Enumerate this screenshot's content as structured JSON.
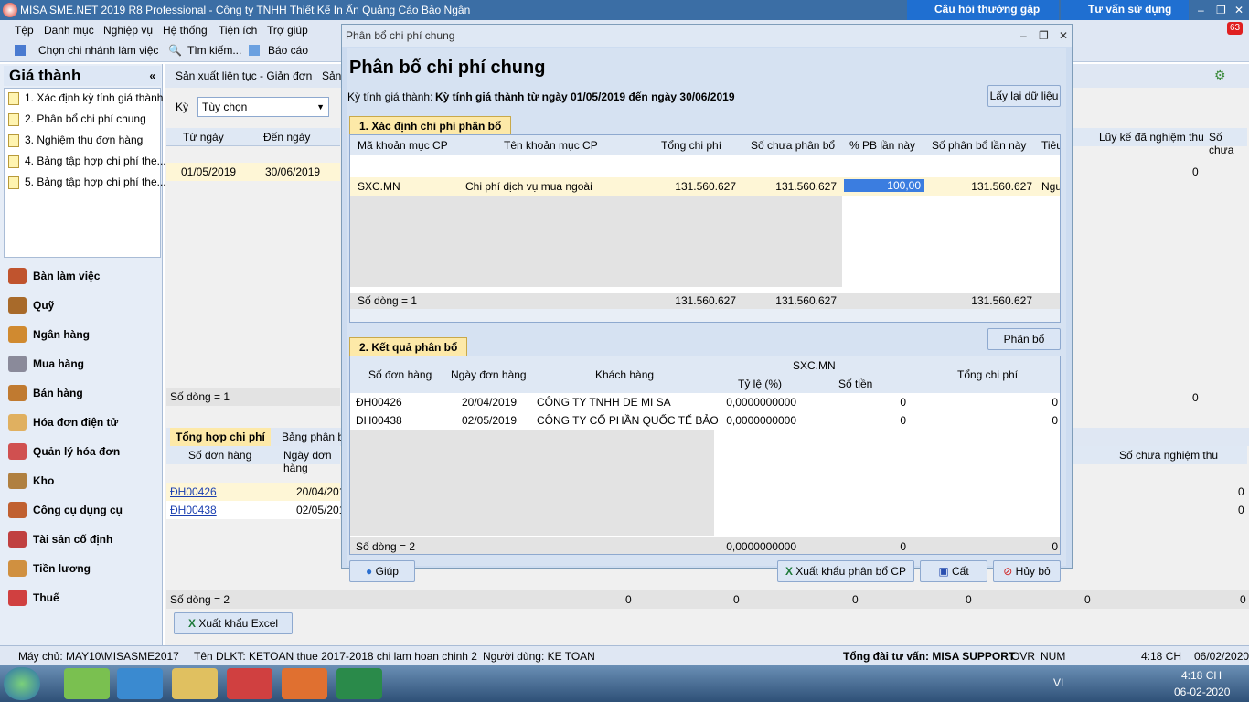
{
  "app": {
    "title": "MISA SME.NET 2019 R8 Professional - Công ty TNHH Thiết Kế In Ấn Quảng Cáo Bảo Ngân",
    "faq": "Câu hỏi thường gặp",
    "consult": "Tư vấn sử dụng",
    "badge": "63"
  },
  "menu": [
    "Tệp",
    "Danh mục",
    "Nghiệp vụ",
    "Hệ thống",
    "Tiện ích",
    "Trợ giúp"
  ],
  "toolbar": {
    "branch": "Chọn chi nhánh làm việc",
    "search": "Tìm kiếm...",
    "report": "Báo cáo"
  },
  "left": {
    "heading": "Giá thành",
    "steps": [
      "1. Xác định kỳ tính giá thành",
      "2. Phân bổ chi phí chung",
      "3. Nghiệm thu đơn hàng",
      "4. Bảng tập hợp chi phí the...",
      "5. Bảng tập hợp chi phí the..."
    ],
    "nav": [
      "Bàn làm việc",
      "Quỹ",
      "Ngân hàng",
      "Mua hàng",
      "Bán hàng",
      "Hóa đơn điện tử",
      "Quản lý hóa đơn",
      "Kho",
      "Công cụ dụng cụ",
      "Tài sản cố định",
      "Tiền lương",
      "Thuế"
    ]
  },
  "main": {
    "tabs": [
      "Sản xuất liên tục - Giản đơn",
      "Sản"
    ],
    "ky_label": "Kỳ",
    "ky_value": "Tùy chọn",
    "cols": [
      "Từ ngày",
      "Đến ngày"
    ],
    "row": [
      "01/05/2019",
      "30/06/2019"
    ],
    "rowcount1": "Số dòng = 1",
    "right_cols": [
      "Lũy kế đã nghiệm thu",
      "Số chưa"
    ],
    "right_vals": [
      "0",
      "0"
    ],
    "bottom_tabs": [
      "Tổng hợp chi phí",
      "Bảng phân bổ"
    ],
    "bottom_cols": [
      "Số đơn hàng",
      "Ngày đơn hàng"
    ],
    "bottom_rows": [
      [
        "ĐH00426",
        "20/04/2019"
      ],
      [
        "ĐH00438",
        "02/05/2019"
      ]
    ],
    "bottom_right_col": "Số chưa nghiệm thu",
    "bottom_right_vals": [
      "0",
      "0"
    ],
    "rowcount2": "Số dòng = 2",
    "totals": [
      "0",
      "0",
      "0",
      "0",
      "0",
      "0"
    ],
    "export": "Xuất khẩu Excel"
  },
  "dialog": {
    "window_title": "Phân bổ chi phí chung",
    "heading": "Phân bổ chi phí chung",
    "period_label": "Kỳ tính giá thành:",
    "period_value": "Kỳ tính giá thành từ ngày 01/05/2019 đến ngày 30/06/2019",
    "reload": "Lấy lại dữ liệu",
    "sec1": "1. Xác định chi phí phân bổ",
    "t1_cols": [
      "Mã khoản mục CP",
      "Tên khoản mục CP",
      "Tổng chi phí",
      "Số chưa phân bổ",
      "% PB lần này",
      "Số phân bổ lần này",
      "Tiêu"
    ],
    "t1_row": [
      "SXC.MN",
      "Chi phí dịch vụ mua ngoài",
      "131.560.627",
      "131.560.627",
      "100,00",
      "131.560.627",
      "Nguy"
    ],
    "t1_footer": [
      "Số dòng = 1",
      "131.560.627",
      "131.560.627",
      "131.560.627"
    ],
    "allocate": "Phân bổ",
    "sec2": "2. Kết quả phân bổ",
    "t2_cols": [
      "Số đơn hàng",
      "Ngày đơn hàng",
      "Khách hàng",
      "SXC.MN",
      "Tỷ lệ (%)",
      "Số tiền",
      "Tổng chi phí"
    ],
    "t2_rows": [
      [
        "ĐH00426",
        "20/04/2019",
        "CÔNG TY TNHH DE MI SA",
        "0,0000000000",
        "0",
        "0"
      ],
      [
        "ĐH00438",
        "02/05/2019",
        "CÔNG TY CỔ PHẦN QUỐC TẾ BẢO",
        "0,0000000000",
        "0",
        "0"
      ]
    ],
    "t2_footer": [
      "Số dòng = 2",
      "0,0000000000",
      "0",
      "0"
    ],
    "help": "Giúp",
    "export": "Xuất khẩu phân bổ CP",
    "save": "Cất",
    "cancel": "Hủy bỏ"
  },
  "status": {
    "server": "Máy chủ: MAY10\\MISASME2017",
    "db": "Tên DLKT: KETOAN thue 2017-2018 chi lam hoan chinh 2",
    "user": "Người dùng: KE TOAN",
    "hotline": "Tổng đài tư vấn: MISA SUPPORT",
    "ovr": "OVR",
    "num": "NUM",
    "time": "4:18 CH",
    "date": "06/02/2020"
  },
  "taskbar": {
    "lang": "VI",
    "time": "4:18 CH",
    "date": "06-02-2020"
  }
}
